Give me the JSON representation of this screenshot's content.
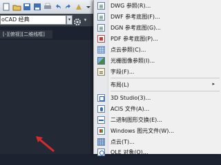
{
  "workspace": {
    "select_value": "oCAD 经典",
    "drop_glyph": "▾",
    "dd_glyph": "▾"
  },
  "document_tab": "[-][俯视][二维线框]",
  "context_menu": {
    "items": [
      {
        "label": "DWG 参照(R)...",
        "icon": "dwg-reference-icon"
      },
      {
        "label": "DWF 参考底图(F)...",
        "icon": "dwf-underlay-icon"
      },
      {
        "label": "DGN 参考底图(G)...",
        "icon": "dgn-underlay-icon"
      },
      {
        "label": "PDF 参考底图(P)...",
        "icon": "pdf-underlay-icon"
      },
      {
        "label": "点云参照(C)...",
        "icon": "point-cloud-icon"
      },
      {
        "label": "光栅图像参照(I)...",
        "icon": "raster-image-icon"
      },
      {
        "label": "字段(F)...",
        "icon": "field-icon"
      },
      {
        "label": "布局(L)",
        "submenu_arrow": "▸"
      },
      {
        "label": "3D Studio(3)...",
        "icon": "3d-studio-icon"
      },
      {
        "label": "ACIS 文件(A)...",
        "icon": "acis-file-icon"
      },
      {
        "label": "二进制图形交换(E)...",
        "icon": "binary-dxf-icon"
      },
      {
        "label": "Windows 图元文件(W)...",
        "icon": "windows-metafile-icon"
      },
      {
        "label": "点云(T)...",
        "icon": "point-cloud-object-icon"
      },
      {
        "label": "OLE 对象(O)...",
        "icon": "ole-object-icon"
      }
    ]
  }
}
